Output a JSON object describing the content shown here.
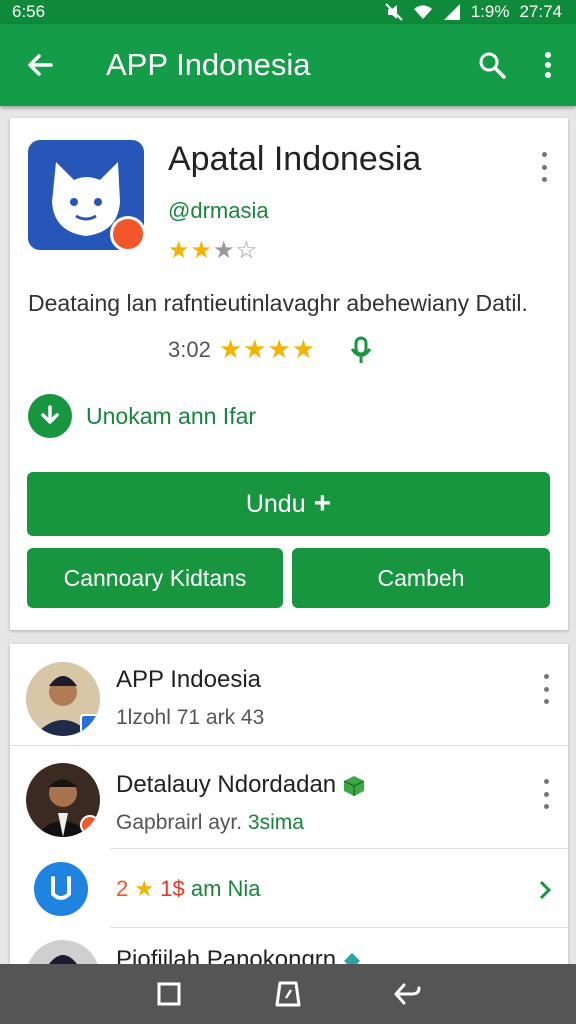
{
  "status_bar": {
    "time_left": "6:56",
    "battery": "1:9%",
    "clock": "27:74"
  },
  "app_bar": {
    "title": "APP Indonesia",
    "icons": [
      "back-arrow-icon",
      "search-icon",
      "more-vert-icon"
    ]
  },
  "app": {
    "name": "Apatal Indonesia",
    "handle": "@drmasia",
    "rating_stars": "★★☆☆☆",
    "description": "Deataing lan rafntieutinlavaghr abehewiany Datil.",
    "rating_count": "3:02",
    "rating_display": "★★★★",
    "download_label": "Unokam ann Ifar",
    "primary_button": "Undu",
    "primary_button_icon": "+",
    "button_left": "Cannoary Kidtans",
    "button_right": "Cambeh"
  },
  "list": [
    {
      "title": "APP Indoesia",
      "subtitle": "1lzohl 71 ark 43",
      "subtitle_color": "#555555"
    },
    {
      "title": "Detalauy Ndordadan",
      "subtitle": "Gapbrairl ayr. 3sima",
      "subtitle_prefix": "Gapbrairl ayr.",
      "subtitle_accent": "3sima",
      "accent_color": "#18853b"
    },
    {
      "title": "",
      "subtitle_parts": [
        "2",
        "★",
        "1",
        "$",
        "am Nia"
      ],
      "subtitle_text": "2 ★ 1$ am Nia"
    },
    {
      "title": "Piofiilah Panokongrn"
    }
  ],
  "colors": {
    "primary": "#149c48",
    "accent": "#18953f",
    "star": "#f3b400",
    "badge_orange": "#f2572b"
  }
}
